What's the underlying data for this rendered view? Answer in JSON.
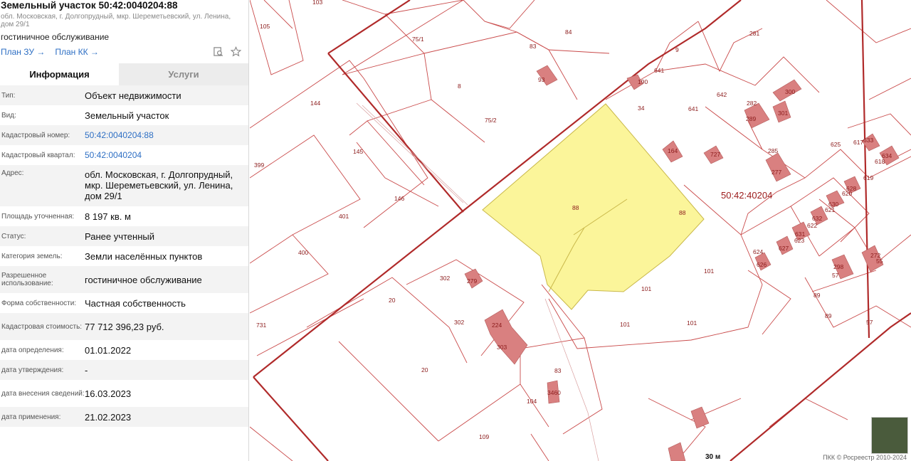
{
  "panel": {
    "title": "Земельный участок 50:42:0040204:88",
    "address_small": "обл. Московская, г. Долгопрудный, мкр. Шереметьевский, ул. Ленина, дом 29/1",
    "purpose": "гостиничное обслуживание",
    "links": {
      "plan_zu": "План ЗУ →",
      "plan_kk": "План КК →"
    },
    "tools": [
      "search-doc-icon",
      "star-icon"
    ],
    "tabs": [
      {
        "label": "Информация"
      },
      {
        "label": "Услуги"
      }
    ],
    "rows": [
      {
        "label": "Тип:",
        "value": "Объект недвижимости"
      },
      {
        "label": "Вид:",
        "value": "Земельный участок"
      },
      {
        "label": "Кадастровый номер:",
        "value": "50:42:0040204:88"
      },
      {
        "label": "Кадастровый квартал:",
        "value": "50:42:0040204"
      },
      {
        "label": "Адрес:",
        "value": "обл. Московская, г. Долгопрудный, мкр. Шереметьевский, ул. Ленина, дом 29/1"
      },
      {
        "label": "Площадь уточненная:",
        "value": "8 197 кв. м"
      },
      {
        "label": "Статус:",
        "value": "Ранее учтенный"
      },
      {
        "label": "Категория земель:",
        "value": "Земли населённых пунктов"
      },
      {
        "label": "Разрешенное использование:",
        "value": "гостиничное обслуживание"
      },
      {
        "label": "Форма собственности:",
        "value": "Частная собственность"
      },
      {
        "label": "Кадастровая стоимость:",
        "value": "77 712 396,23 руб."
      },
      {
        "label": "дата определения:",
        "value": "01.01.2022"
      },
      {
        "label": "дата утверждения:",
        "value": "-"
      },
      {
        "label": "дата внесения сведений:",
        "value": "16.03.2023"
      },
      {
        "label": "дата применения:",
        "value": "21.02.2023"
      }
    ]
  },
  "map": {
    "quarter_label": "50:42:40204",
    "scale": "30 м",
    "copyright": "ПКК © Росреестр 2010-2024",
    "parcel_labels": [
      "103",
      "105",
      "75/1",
      "84",
      "83",
      "281",
      "9",
      "641",
      "642",
      "8",
      "75/2",
      "34",
      "641",
      "282",
      "144",
      "145",
      "146",
      "399",
      "401",
      "400",
      "88",
      "88",
      "285",
      "625",
      "617",
      "618",
      "619",
      "620",
      "621",
      "622",
      "623",
      "624",
      "101",
      "101",
      "101",
      "101",
      "302",
      "302",
      "303",
      "20",
      "20",
      "731",
      "83",
      "104",
      "109",
      "57",
      "55",
      "89",
      "89",
      "57"
    ],
    "building_labels": [
      "93",
      "190",
      "300",
      "289",
      "301",
      "164",
      "727",
      "277",
      "633",
      "634",
      "628",
      "630",
      "632",
      "631",
      "627",
      "626",
      "272",
      "279",
      "224",
      "3460",
      "298"
    ],
    "colors": {
      "boundary": "#c0392b",
      "selected_fill": "#fbf59a",
      "building": "#d98080"
    },
    "selected_parcel": "50:42:0040204:88"
  }
}
